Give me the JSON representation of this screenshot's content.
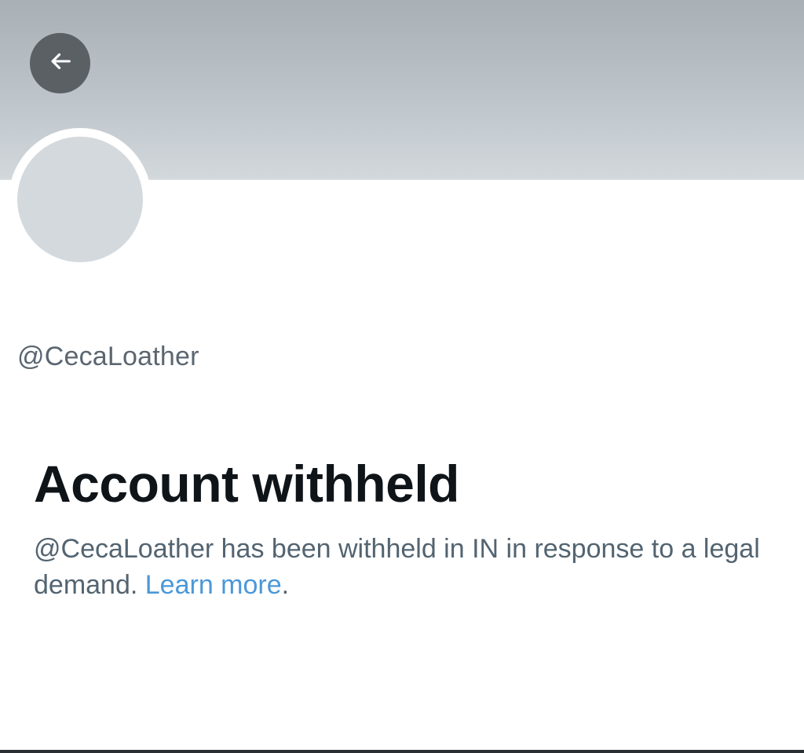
{
  "header": {
    "back_icon": "arrow-left-icon",
    "banner_color_top": "#a9b0b5",
    "banner_color_bottom": "#d2d8dc"
  },
  "profile": {
    "handle": "@CecaLoather"
  },
  "notice": {
    "title": "Account withheld",
    "message_text": "@CecaLoather has been withheld in IN in response to a legal demand. ",
    "link_label": "Learn more",
    "trailing": ".",
    "link_color": "#4a98d8"
  }
}
